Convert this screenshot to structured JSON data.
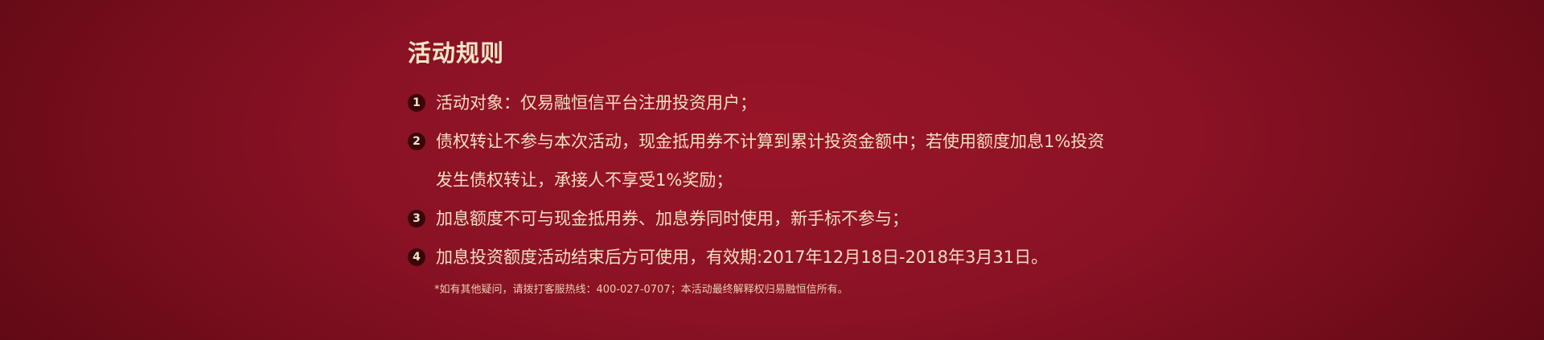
{
  "section": {
    "title": "活动规则"
  },
  "rules": [
    {
      "number": "1",
      "text": "活动对象：仅易融恒信平台注册投资用户；"
    },
    {
      "number": "2",
      "text": "债权转让不参与本次活动，现金抵用券不计算到累计投资金额中；若使用额度加息1%投资",
      "continuation": "发生债权转让，承接人不享受1%奖励；"
    },
    {
      "number": "3",
      "text": "加息额度不可与现金抵用券、加息券同时使用，新手标不参与；"
    },
    {
      "number": "4",
      "text": "加息投资额度活动结束后方可使用，有效期:2017年12月18日-2018年3月31日。"
    }
  ],
  "footnote": "*如有其他疑问，请拨打客服热线：400-027-0707；本活动最终解释权归易融恒信所有。",
  "colors": {
    "background": "#8a1225",
    "text": "#f1dfc0",
    "badge": "#3a0409"
  }
}
